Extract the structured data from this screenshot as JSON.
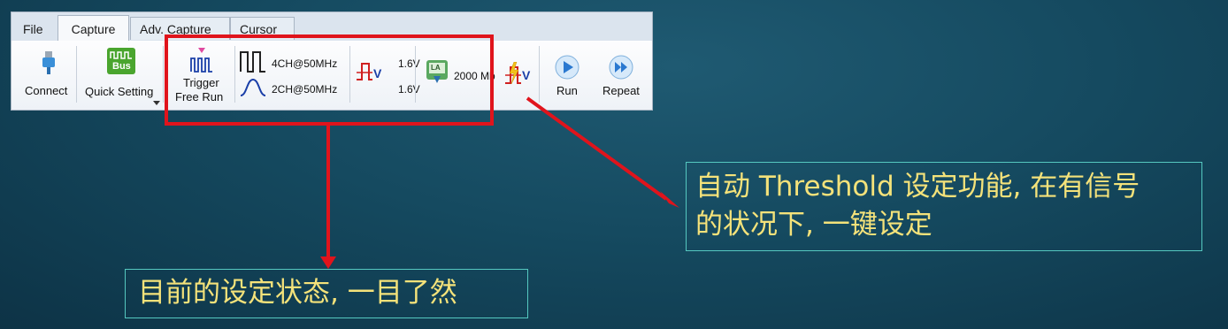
{
  "ribbon": {
    "tabs": [
      "File",
      "Capture",
      "Adv. Capture",
      "Cursor"
    ],
    "buttons": {
      "connect": "Connect",
      "quick_setting": "Quick Setting",
      "bus_badge": "Bus",
      "trigger_line1": "Trigger",
      "trigger_line2": "Free Run",
      "channels_digital": "4CH@50MHz",
      "channels_analog": "2CH@50MHz",
      "threshold_high": "1.6V",
      "threshold_low": "1.6V",
      "la_badge": "LA",
      "memory_depth": "2000 Mb",
      "run": "Run",
      "repeat": "Repeat"
    }
  },
  "annotations": {
    "threshold_note": [
      "自动 Threshold 设定功能, 在有信号",
      "的状况下, 一键设定"
    ],
    "status_note": "目前的设定状态, 一目了然"
  },
  "colors": {
    "highlight_red": "#e0141c",
    "note_text": "#f4e27a",
    "note_border": "#55c8c0"
  }
}
